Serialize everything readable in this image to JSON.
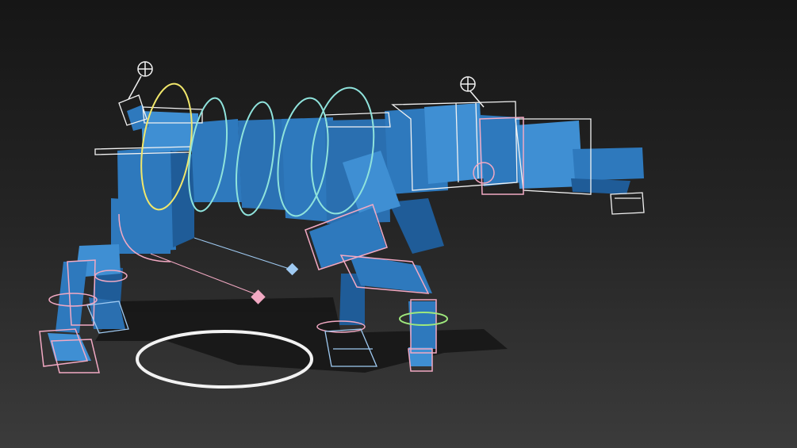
{
  "viewport": {
    "subject": "quadruped-rig",
    "colors": {
      "background_top": "#161616",
      "background_bottom": "#3a3a3a",
      "mesh": "#2e79bd",
      "mesh_dark": "#1f5c98",
      "mesh_light": "#3f8fd3",
      "control_white": "#f2f2f2",
      "control_cyan": "#8fe3dc",
      "control_yellow": "#f1e76b",
      "control_pink": "#f2a9c3",
      "control_lightblue": "#9fcaf2",
      "control_green": "#9ee87d",
      "shadow": "#151515"
    },
    "icons": [
      "crosshair-icon",
      "pole-vector-diamond-icon"
    ]
  }
}
